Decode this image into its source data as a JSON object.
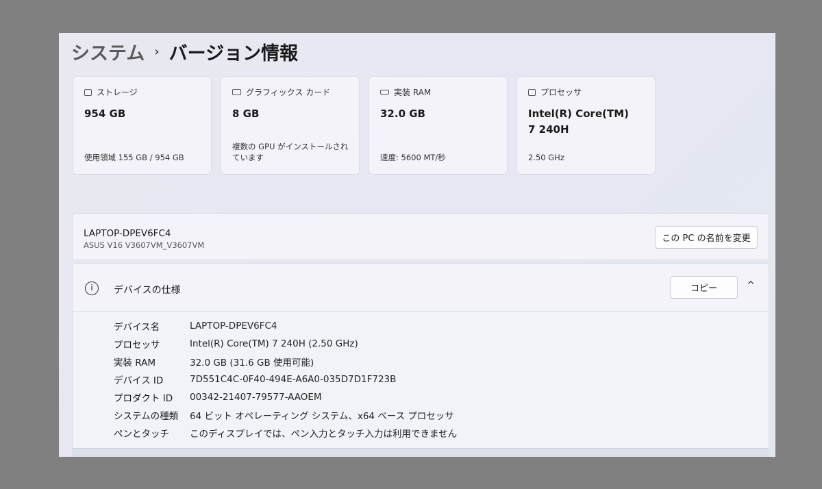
{
  "breadcrumb": {
    "parent": "システム",
    "separator": "›",
    "current": "バージョン情報"
  },
  "cards": [
    {
      "icon": "storage-icon",
      "label": "ストレージ",
      "value": "954 GB",
      "sub": "使用領域 155 GB / 954 GB"
    },
    {
      "icon": "graphics-card-icon",
      "label": "グラフィックス カード",
      "value": "8 GB",
      "sub": "複数の GPU がインストールされています"
    },
    {
      "icon": "ram-icon",
      "label": "実装 RAM",
      "value": "32.0 GB",
      "sub": "速度: 5600 MT/秒"
    },
    {
      "icon": "processor-icon",
      "label": "プロセッサ",
      "value": "Intel(R) Core(TM) 7 240H",
      "sub": "2.50 GHz"
    }
  ],
  "device": {
    "name": "LAPTOP-DPEV6FC4",
    "model": "ASUS V16 V3607VM_V3607VM",
    "rename_button": "この PC の名前を変更"
  },
  "spec": {
    "title": "デバイスの仕様",
    "copy_button": "コピー",
    "info_icon": "i",
    "chevron": "^",
    "rows": [
      {
        "k": "デバイス名",
        "v": "LAPTOP-DPEV6FC4"
      },
      {
        "k": "プロセッサ",
        "v": "Intel(R) Core(TM) 7 240H (2.50 GHz)"
      },
      {
        "k": "実装 RAM",
        "v": "32.0 GB (31.6 GB 使用可能)"
      },
      {
        "k": "デバイス ID",
        "v": "7D551C4C-0F40-494E-A6A0-035D7D1F723B"
      },
      {
        "k": "プロダクト ID",
        "v": "00342-21407-79577-AAOEM"
      },
      {
        "k": "システムの種類",
        "v": "64 ビット オペレーティング システム、x64 ベース プロセッサ"
      },
      {
        "k": "ペンとタッチ",
        "v": "このディスプレイでは、ペン入力とタッチ入力は利用できません"
      }
    ]
  }
}
